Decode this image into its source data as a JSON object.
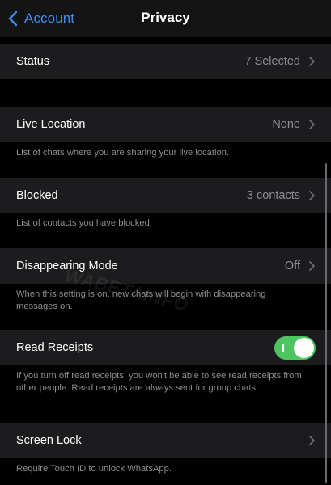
{
  "nav": {
    "back_label": "Account",
    "title": "Privacy"
  },
  "rows": {
    "status": {
      "label": "Status",
      "value": "7 Selected"
    },
    "live_location": {
      "label": "Live Location",
      "value": "None",
      "note": "List of chats where you are sharing your live location."
    },
    "blocked": {
      "label": "Blocked",
      "value": "3 contacts",
      "note": "List of contacts you have blocked."
    },
    "disappearing": {
      "label": "Disappearing Mode",
      "value": "Off",
      "note": "When this setting is on, new chats will begin with disappearing messages on."
    },
    "read_receipts": {
      "label": "Read Receipts",
      "enabled": true,
      "note": "If you turn off read receipts, you won't be able to see read receipts from other people. Read receipts are always sent for group chats."
    },
    "screen_lock": {
      "label": "Screen Lock",
      "note": "Require Touch ID to unlock WhatsApp."
    }
  },
  "watermark": "WABETAINFO",
  "colors": {
    "accent": "#3f8ef5",
    "toggle_on": "#4cc65f",
    "cell_bg": "#1c1c1e",
    "secondary_text": "#8d8d92"
  }
}
